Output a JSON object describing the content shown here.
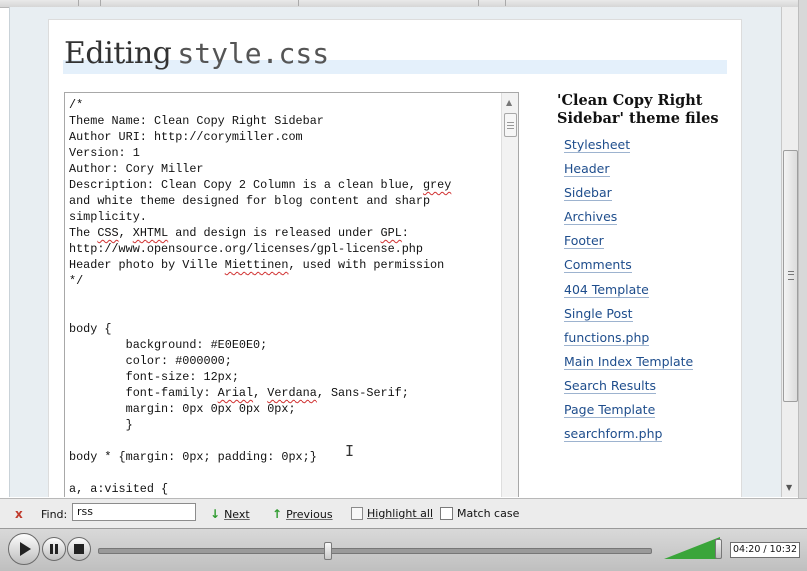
{
  "page": {
    "title_word": "Editing",
    "title_file": "style.css"
  },
  "editor": {
    "lines": [
      "/*",
      "Theme Name: Clean Copy Right Sidebar",
      "Author URI: http://corymiller.com",
      "Version: 1",
      "Author: Cory Miller",
      "Description: Clean Copy 2 Column is a clean blue, grey",
      "and white theme designed for blog content and sharp",
      "simplicity.",
      "The CSS, XHTML and design is released under GPL:",
      "http://www.opensource.org/licenses/gpl-license.php",
      "Header photo by Ville Miettinen, used with permission",
      "*/",
      "",
      "",
      "body {",
      "        background: #E0E0E0;",
      "        color: #000000;",
      "        font-size: 12px;",
      "        font-family: Arial, Verdana, Sans-Serif;",
      "        margin: 0px 0px 0px 0px;",
      "        }",
      "",
      "body * {margin: 0px; padding: 0px;}",
      "",
      "a, a:visited {"
    ]
  },
  "sidebar": {
    "title": "'Clean Copy Right Sidebar' theme files",
    "files": [
      "Stylesheet",
      "Header",
      "Sidebar",
      "Archives",
      "Footer",
      "Comments",
      "404 Template",
      "Single Post",
      "functions.php",
      "Main Index Template",
      "Search Results",
      "Page Template",
      "searchform.php"
    ]
  },
  "findbar": {
    "close_glyph": "x",
    "label": "Find:",
    "value": "rss",
    "next_label": "Next",
    "previous_label": "Previous",
    "highlight_label": "Highlight all",
    "match_case_label": "Match case"
  },
  "player": {
    "time_display": "04:20 / 10:32",
    "progress": 0.415,
    "volume": 0.9
  }
}
